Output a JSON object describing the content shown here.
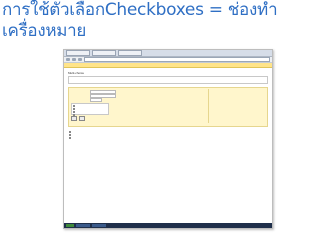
{
  "slide": {
    "title": "การใช้ตัวเลือกCheckboxes = ช่องทำเครื่องหมาย"
  },
  "screenshot": {
    "browser": {
      "tabs": [
        "",
        "",
        ""
      ]
    },
    "panel_title": "Multi-choice",
    "description_text": "",
    "form": {
      "rows": [
        {
          "label": "",
          "value": ""
        },
        {
          "label": "",
          "value": ""
        },
        {
          "label": "",
          "value": ""
        }
      ],
      "options": [
        "",
        "",
        "",
        ""
      ],
      "buttons": [
        "",
        ""
      ]
    },
    "preview": {
      "title": "",
      "options": [
        "",
        "",
        ""
      ]
    }
  },
  "colors": {
    "title": "#2f6fc4",
    "highlight": "#fff6cc",
    "toolbar_strip": "#ffe48a",
    "taskbar": "#1f2f4a"
  }
}
